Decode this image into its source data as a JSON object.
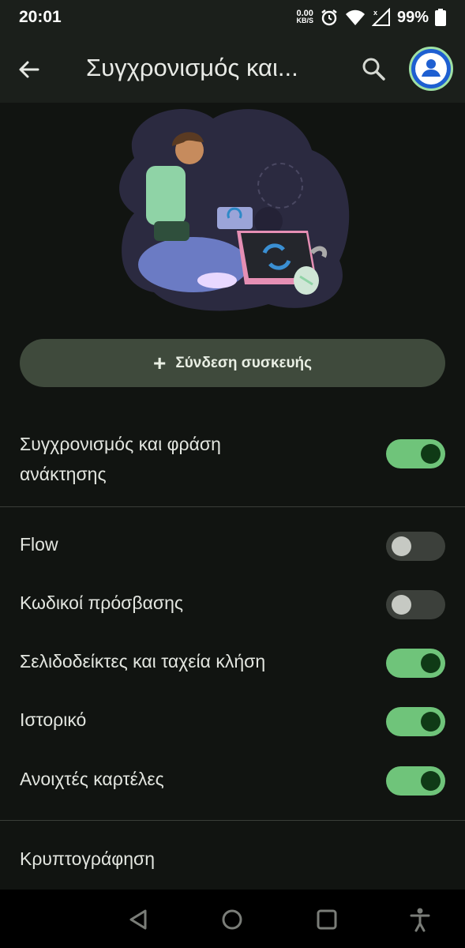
{
  "status_bar": {
    "time": "20:01",
    "net_speed_value": "0.00",
    "net_speed_unit": "KB/S",
    "battery": "99%"
  },
  "app_bar": {
    "title": "Συγχρονισμός και...",
    "back_icon": "arrow-back-icon",
    "search_icon": "search-icon",
    "avatar_icon": "account-avatar-icon"
  },
  "link_device": {
    "label": "Σύνδεση συσκευής"
  },
  "sync_master": {
    "label_line1": "Συγχρονισμός και φράση",
    "label_line2": "ανάκτησης",
    "enabled": true
  },
  "sync_items": [
    {
      "label": "Flow",
      "enabled": false
    },
    {
      "label": "Κωδικοί πρόσβασης",
      "enabled": false
    },
    {
      "label": "Σελιδοδείκτες και ταχεία κλήση",
      "enabled": true
    },
    {
      "label": "Ιστορικό",
      "enabled": true
    },
    {
      "label": "Ανοιχτές καρτέλες",
      "enabled": true
    }
  ],
  "encryption": {
    "label": "Κρυπτογράφηση"
  },
  "colors": {
    "toggle_on": "#6fc47a",
    "toggle_off": "#3c403b",
    "button_bg": "#3f4a3c",
    "avatar_blue": "#1e5fd1"
  }
}
